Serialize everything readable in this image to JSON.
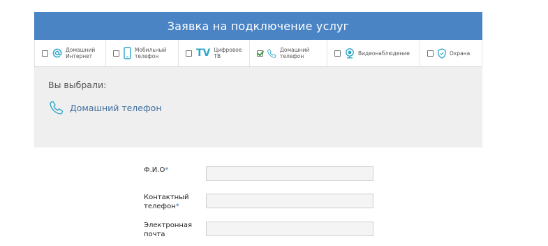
{
  "header": {
    "title": "Заявка на подключение услуг"
  },
  "services": [
    {
      "label_line1": "Домашний",
      "label_line2": "Интернет",
      "icon": "at-sign-icon",
      "checked": false
    },
    {
      "label_line1": "Мобильный",
      "label_line2": "телефон",
      "icon": "mobile-phone-icon",
      "checked": false
    },
    {
      "label_line1": "Цифровое",
      "label_line2": "ТВ",
      "icon_text": "TV",
      "icon": "tv-icon",
      "checked": false
    },
    {
      "label_line1": "Домашний",
      "label_line2": "телефон",
      "icon": "phone-handset-icon",
      "checked": true
    },
    {
      "label_line1": "Видеонаблюдение",
      "label_line2": "",
      "icon": "webcam-icon",
      "checked": false
    },
    {
      "label_line1": "Охрана",
      "label_line2": "",
      "icon": "shield-icon",
      "checked": false
    }
  ],
  "chosen": {
    "title": "Вы выбрали:",
    "item_label": "Домашний телефон",
    "item_icon": "phone-handset-icon"
  },
  "form": {
    "fio_label": "Ф.И.О",
    "fio_value": "",
    "phone_label_line1": "Контактный",
    "phone_label_line2": "телефон",
    "phone_value": "",
    "email_label_line1": "Электронная",
    "email_label_line2": "почта",
    "email_value": "",
    "required_mark": "*"
  },
  "colors": {
    "header_bg": "#4a84c4",
    "icon": "#2ea6c8",
    "chosen_bg": "#efefef"
  }
}
